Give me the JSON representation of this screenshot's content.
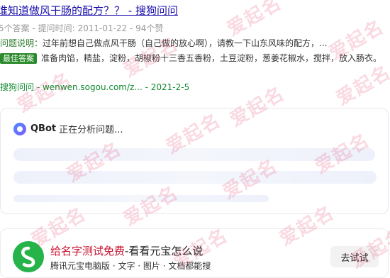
{
  "result": {
    "title": "谁知道做风干肠的配方？？ - 搜狗问问",
    "meta": "5个答案 - 提问时间: 2011-01-22 - 94个赞",
    "question_label": "问题说明：",
    "question_text": "过年前想自己做点风干肠（自己做的放心啊），请教一下山东风味的配方，...",
    "answer_tag": "最佳答案",
    "answer_text": "准备肉馅，精盐，淀粉，胡椒粉十三香五香粉，土豆淀粉，葱姜花椒水，搅拌，放入肠衣。",
    "source_name": "搜狗问问",
    "source_url": " - wenwen.sogou.com/z... - 2021-2-5"
  },
  "qbot": {
    "name": "QBot",
    "status": "正在分析问题..."
  },
  "ad": {
    "title_highlight": "给名字测试免费",
    "title_rest": "-看看元宝怎么说",
    "subtitle": "腾讯元宝电脑版 · 文字 · 图片 · 文档都能搜",
    "button_label": "去试试",
    "brand_color": "#26b34a"
  },
  "watermark": {
    "text": "爱起名"
  }
}
